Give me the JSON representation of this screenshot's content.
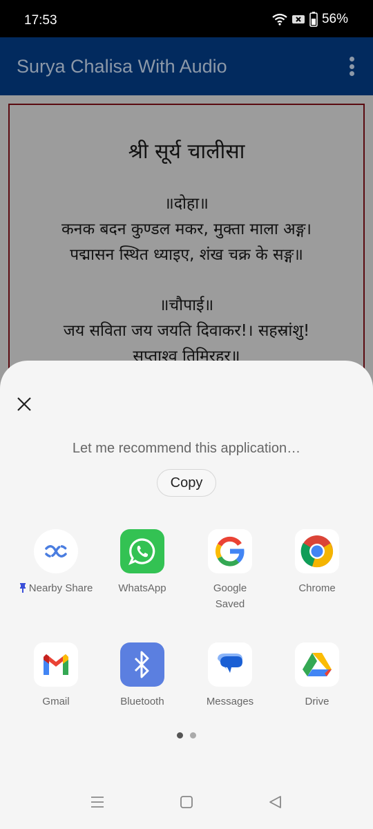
{
  "status_bar": {
    "time": "17:53",
    "icons": [
      "wifi-icon",
      "no-sim-icon",
      "battery-icon"
    ],
    "battery_percent": "56%"
  },
  "app_bar": {
    "title": "Surya Chalisa With Audio",
    "menu_icon": "more-vert-icon"
  },
  "content": {
    "title": "श्री सूर्य चालीसा",
    "lines": [
      "॥दोहा॥",
      "कनक बदन कुण्डल मकर, मुक्ता माला अङ्ग।",
      "पद्मासन स्थित ध्याइए, शंख चक्र के सङ्ग॥",
      "",
      "॥चौपाई॥",
      "जय सविता जय जयति दिवाकर!। सहस्रांशु!",
      "सप्ताश्व तिमिरहर॥"
    ]
  },
  "share_sheet": {
    "close_icon": "close-icon",
    "message": "Let me recommend this application…",
    "copy_label": "Copy",
    "apps": [
      {
        "label": "Nearby Share",
        "icon": "nearby-share-icon",
        "pinned": true
      },
      {
        "label": "WhatsApp",
        "icon": "whatsapp-icon"
      },
      {
        "label": "Google\nSaved",
        "line1": "Google",
        "line2": "Saved",
        "icon": "google-icon"
      },
      {
        "label": "Chrome",
        "icon": "chrome-icon"
      },
      {
        "label": "Gmail",
        "icon": "gmail-icon"
      },
      {
        "label": "Bluetooth",
        "icon": "bluetooth-icon"
      },
      {
        "label": "Messages",
        "icon": "messages-icon"
      },
      {
        "label": "Drive",
        "icon": "drive-icon"
      }
    ],
    "page_indicator": {
      "current": 1,
      "total": 2
    }
  },
  "nav_bar": {
    "buttons": [
      "recents-icon",
      "home-icon",
      "back-icon"
    ]
  },
  "colors": {
    "app_bar": "#022a5e",
    "frame_border": "#5a0a10",
    "sheet_bg": "#f5f5f5",
    "pin": "#3a4fd8"
  }
}
